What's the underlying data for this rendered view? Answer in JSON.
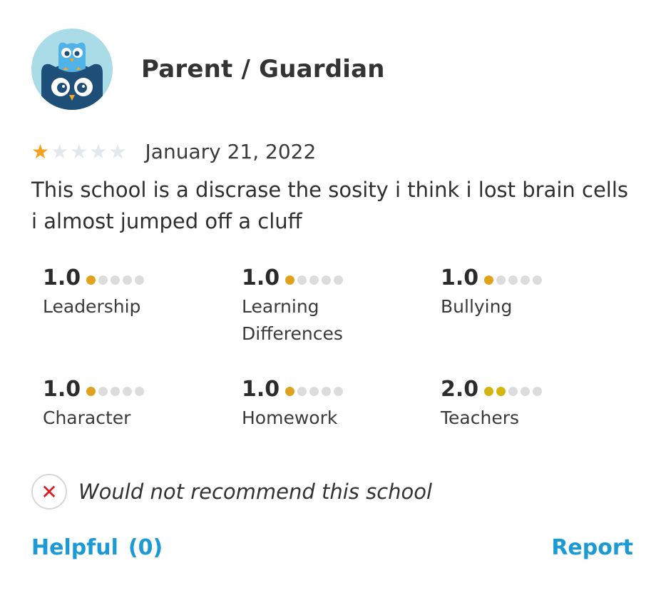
{
  "reviewer": {
    "role": "Parent / Guardian",
    "avatar_icon": "owl-avatar-icon"
  },
  "review": {
    "star_rating": 1,
    "star_max": 5,
    "date": "January 21, 2022",
    "text": "This school is a discrase the sosity i think i lost brain cells i almost jumped off a cluff"
  },
  "topics": [
    {
      "score": "1.0",
      "value": 1,
      "label": "Leadership"
    },
    {
      "score": "1.0",
      "value": 1,
      "label": "Learning Differences"
    },
    {
      "score": "1.0",
      "value": 1,
      "label": "Bullying"
    },
    {
      "score": "1.0",
      "value": 1,
      "label": "Character"
    },
    {
      "score": "1.0",
      "value": 1,
      "label": "Homework"
    },
    {
      "score": "2.0",
      "value": 2,
      "label": "Teachers"
    }
  ],
  "recommendation": {
    "icon": "x-icon",
    "text": "Would not recommend this school"
  },
  "actions": {
    "helpful_label": "Helpful",
    "helpful_count": "(0)",
    "report_label": "Report"
  },
  "colors": {
    "accent": "#1b9ad6",
    "star_on": "#f4a11c",
    "dot_on": "#e0a21d",
    "x_red": "#e0191e"
  }
}
